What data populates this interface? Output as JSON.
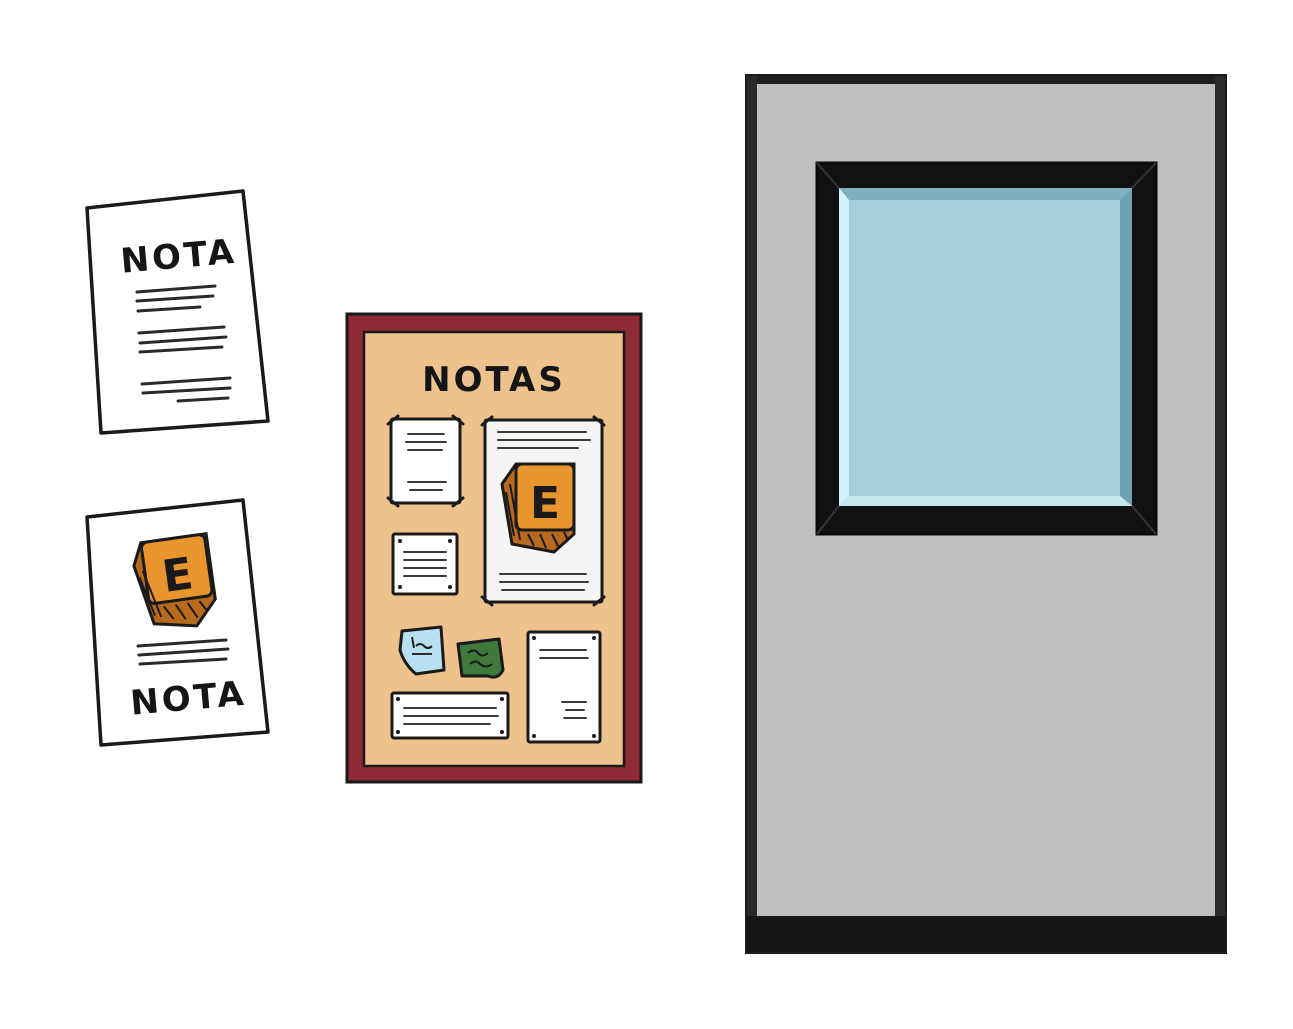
{
  "notes": {
    "top_note_title": "NOTA",
    "bottom_note_title": "NOTA"
  },
  "board": {
    "title": "NOTAS"
  },
  "icons": {
    "e_badge_letter": "E"
  },
  "colors": {
    "board_frame": "#8e2a34",
    "cork": "#edc28c",
    "door": "#c0c0c0",
    "window_glass": "#a8cedc",
    "badge_orange": "#e8952e",
    "sticky_blue": "#b8e0f2",
    "sticky_green": "#3f7a3c"
  }
}
